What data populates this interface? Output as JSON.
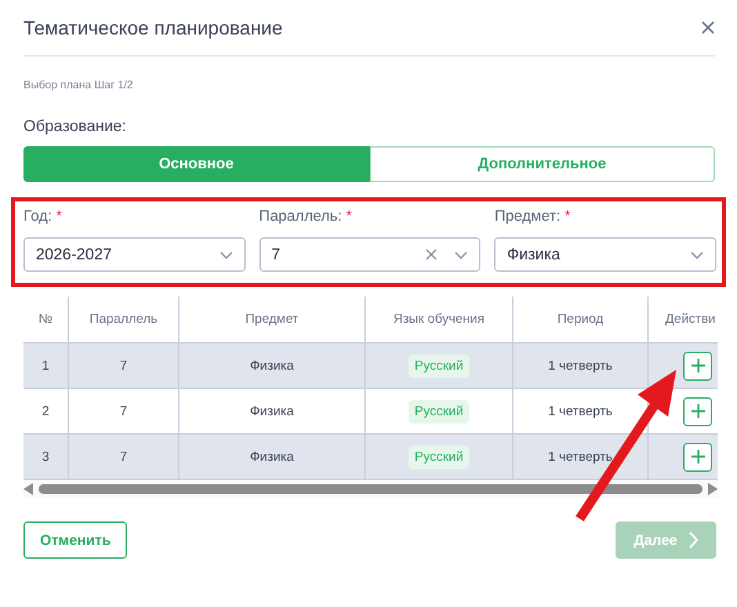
{
  "dialog": {
    "title": "Тематическое планирование",
    "step": "Выбор плана Шаг 1/2"
  },
  "education": {
    "label": "Образование:",
    "options": [
      {
        "label": "Основное",
        "selected": true
      },
      {
        "label": "Дополнительное",
        "selected": false
      }
    ]
  },
  "filters": [
    {
      "label": "Год:",
      "required_mark": "*",
      "value": "2026-2027",
      "clearable": false
    },
    {
      "label": "Параллель:",
      "required_mark": "*",
      "value": "7",
      "clearable": true
    },
    {
      "label": "Предмет:",
      "required_mark": "*",
      "value": "Физика",
      "clearable": false
    }
  ],
  "table": {
    "columns": [
      "№",
      "Параллель",
      "Предмет",
      "Язык обучения",
      "Период",
      "Действи"
    ],
    "rows": [
      {
        "number": "1",
        "grade": "7",
        "subject": "Физика",
        "language": "Русский",
        "period": "1 четверть"
      },
      {
        "number": "2",
        "grade": "7",
        "subject": "Физика",
        "language": "Русский",
        "period": "1 четверть"
      },
      {
        "number": "3",
        "grade": "7",
        "subject": "Физика",
        "language": "Русский",
        "period": "1 четверть"
      }
    ]
  },
  "buttons": {
    "cancel": {
      "label": "Отменить"
    },
    "next": {
      "label": "Далее",
      "disabled": true
    }
  }
}
